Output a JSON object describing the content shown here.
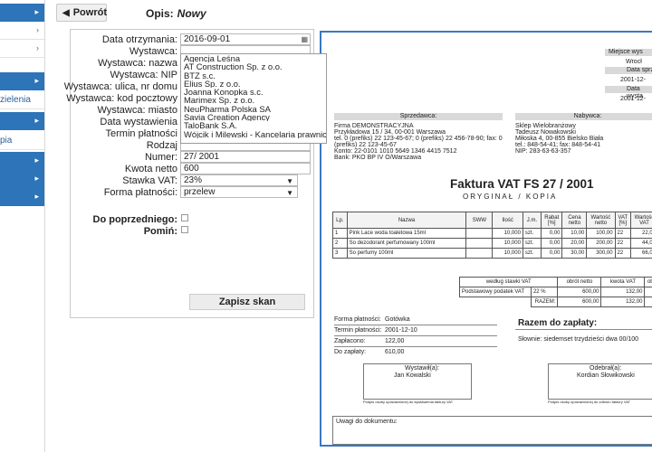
{
  "sidebar": {
    "items": [
      {
        "label": "",
        "style": "blue"
      },
      {
        "label": "",
        "style": "white"
      },
      {
        "label": "",
        "style": "white"
      },
      {
        "label": "",
        "style": "blue"
      },
      {
        "label": "zielenia",
        "style": "white"
      },
      {
        "label": "",
        "style": "blue"
      },
      {
        "label": "pia",
        "style": "white"
      },
      {
        "label": "",
        "style": "blue"
      },
      {
        "label": "",
        "style": "blue"
      },
      {
        "label": "",
        "style": "blue"
      }
    ]
  },
  "toolbar": {
    "back_label": "Powrót",
    "title_label": "Opis:",
    "title_value": "Nowy"
  },
  "form": {
    "date_received_label": "Data otrzymania:",
    "date_received_value": "2016-09-01",
    "issuer_label": "Wystawca:",
    "issuer_name_label": "Wystawca: nazwa",
    "issuer_nip_label": "Wystawca: NIP",
    "issuer_street_label": "Wystawca: ulica, nr domu",
    "issuer_postcode_label": "Wystawca: kod pocztowy",
    "issuer_city_label": "Wystawca: miasto",
    "issue_date_label": "Data wystawienia",
    "payment_due_label": "Termin płatności",
    "type_label": "Rodzaj",
    "number_label": "Numer:",
    "number_value": "27/ 2001",
    "net_label": "Kwota netto",
    "net_value": "600",
    "vat_label": "Stawka VAT:",
    "vat_value": "23%",
    "payment_form_label": "Forma płatności:",
    "payment_form_value": "przelew",
    "previous_label": "Do poprzedniego:",
    "skip_label": "Pomiń:",
    "save_label": "Zapisz skan"
  },
  "dropdown": {
    "options": [
      "Agencja Leśna",
      "AT Construction Sp. z o.o.",
      "BTZ s.c.",
      "Elius Sp. z o.o.",
      "Joanna Konopka s.c.",
      "Marimex Sp. z o.o.",
      "NeuPharma Polska SA",
      "Savia Creation Agency",
      "TaloBank S.A.",
      "Wójcik i Milewski - Kancelaria prawnicza"
    ]
  },
  "invoice": {
    "place_label": "Miejsce wys",
    "place_value": "Wrocł",
    "date1_label": "Data sprz",
    "date1_value": "2001-12-",
    "date2_label": "Data wysta",
    "date2_value": "2001-12-",
    "seller_header": "Sprzedawca:",
    "seller_lines": [
      "Firma DEMONSTRACYJNA",
      "Przykładowa 15 / 34, 00-001 Warszawa",
      "tel. 0 (prefiks) 22 123-45-67; 0 (prefiks) 22 456-78-90; fax: 0",
      "(prefiks) 22 123-45-67",
      "Konto: 22-0101 1010 5649 1346 4415 7512",
      "Bank: PKO BP IV O/Warszawa"
    ],
    "buyer_header": "Nabywca:",
    "buyer_lines": [
      "Sklep Wielobranżowy",
      "Tadeusz Nowakowski",
      "Miłoska 4, 00-855 Bielsko Biała",
      "tel.: 848-54-41; fax: 848-54-41",
      "NIP: 283-63-63-357"
    ],
    "title": "Faktura VAT FS 27 / 2001",
    "subtitle": "ORYGINAŁ / KOPIA",
    "items_headers": [
      "Lp.",
      "Nazwa",
      "SWW",
      "Ilość",
      "J.m.",
      "Rabat [%]",
      "Cena netto",
      "Wartość netto",
      "VAT [%]",
      "Wartość VAT"
    ],
    "items": [
      [
        "1",
        "Pink Lace woda toaletowa 15ml",
        "",
        "10,000",
        "szt.",
        "0,00",
        "10,00",
        "100,00",
        "22",
        "22,00"
      ],
      [
        "2",
        "So dezodorant perfumowany 100ml",
        "",
        "10,000",
        "szt.",
        "0,00",
        "20,00",
        "200,00",
        "22",
        "44,00"
      ],
      [
        "3",
        "So perfumy 100ml",
        "",
        "10,000",
        "szt.",
        "0,00",
        "30,00",
        "300,00",
        "22",
        "66,00"
      ]
    ],
    "vat_table_headers": [
      "według stawki VAT",
      "obrót netto",
      "kwota VAT",
      "obr"
    ],
    "vat_rows": [
      [
        "Podstawowy podatek VAT",
        "22 %",
        "600,00",
        "132,00",
        "7"
      ],
      [
        "",
        "RAZEM:",
        "600,00",
        "132,00",
        "7"
      ]
    ],
    "payment_rows": [
      [
        "Forma płatności:",
        "Gotówka"
      ],
      [
        "Termin płatności:",
        "2001-12-10"
      ],
      [
        "Zapłacono:",
        "122,00"
      ],
      [
        "Do zapłaty:",
        "610,00"
      ]
    ],
    "total_label": "Razem do zapłaty:",
    "words_label": "Słownie: siedemset trzydzieści dwa 00/100",
    "issued_by_label": "Wystawił(a):",
    "issued_by_name": "Jan Kowalski",
    "received_by_label": "Odebrał(a):",
    "received_by_name": "Kordian Słowikowski",
    "sign_caption": "Podpis osoby upoważnionej do wystawienia faktury VAT",
    "sign_caption2": "Podpis osoby upoważnionej do odbioru faktury VAT",
    "notes_label": "Uwagi do dokumentu:"
  }
}
